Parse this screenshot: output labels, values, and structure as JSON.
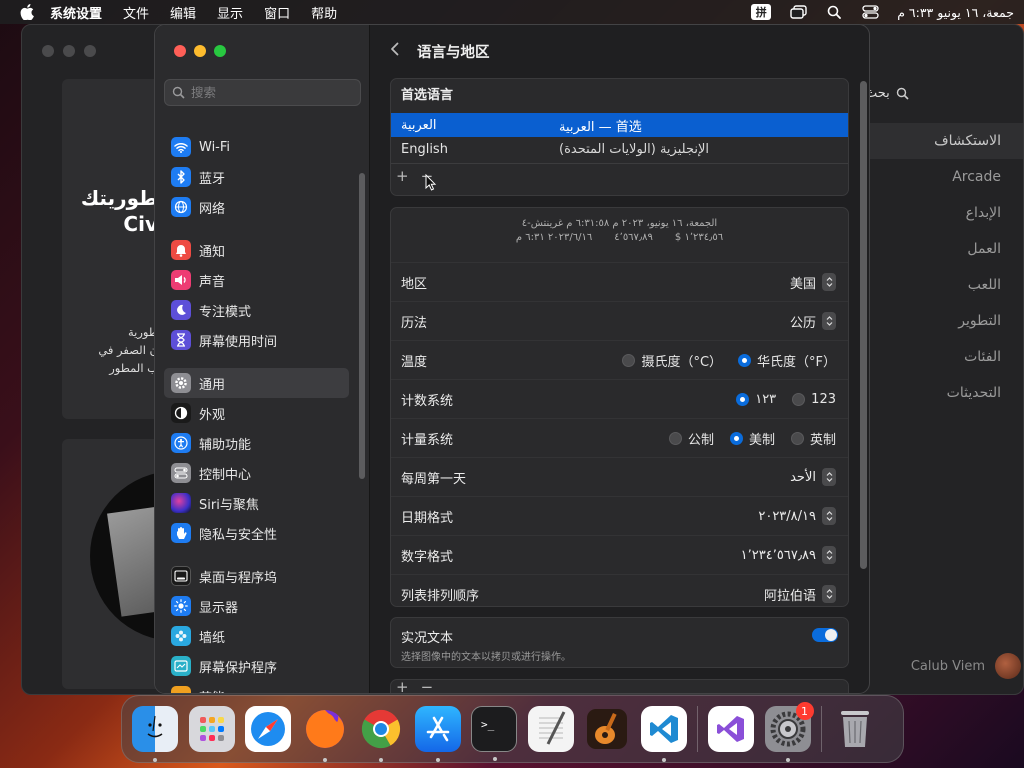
{
  "menubar": {
    "app_name": "系统设置",
    "menus": [
      "文件",
      "编辑",
      "显示",
      "窗口",
      "帮助"
    ],
    "input_method": "拼",
    "clock": "جمعة، ١٦ يونيو ٦:٣٣ م"
  },
  "appstore_bg": {
    "card_title_line1": "طوريتك",
    "card_title_line2": "Civ",
    "card_desc_line1": "طورية",
    "card_desc_line2": "ن الصفر في",
    "card_desc_line3": "ب المطور",
    "search_label": "بحث",
    "sidebar_items": [
      "الاستكشاف",
      "Arcade",
      "الإبداع",
      "العمل",
      "اللعب",
      "التطوير",
      "الفئات",
      "التحديثات"
    ],
    "account_name": "Calub Viem"
  },
  "sidebar": {
    "search_placeholder": "搜索",
    "items": [
      {
        "label": "Wi-Fi",
        "icon": "wifi-icon",
        "color": "#1e7cf2"
      },
      {
        "label": "蓝牙",
        "icon": "bluetooth-icon",
        "color": "#1e7cf2"
      },
      {
        "label": "网络",
        "icon": "globe-icon",
        "color": "#1e7cf2"
      },
      {
        "label": "通知",
        "icon": "bell-icon",
        "color": "#ee4b43"
      },
      {
        "label": "声音",
        "icon": "speaker-icon",
        "color": "#ee3c73"
      },
      {
        "label": "专注模式",
        "icon": "moon-icon",
        "color": "#5d4fd8"
      },
      {
        "label": "屏幕使用时间",
        "icon": "hourglass-icon",
        "color": "#5d4fd8"
      },
      {
        "label": "通用",
        "icon": "gear-icon",
        "color": "#8e8e93"
      },
      {
        "label": "外观",
        "icon": "appearance-icon",
        "color": "#1a1a1a"
      },
      {
        "label": "辅助功能",
        "icon": "accessibility-icon",
        "color": "#1e7cf2"
      },
      {
        "label": "控制中心",
        "icon": "control-center-icon",
        "color": "#8e8e93"
      },
      {
        "label": "Siri与聚焦",
        "icon": "siri-icon",
        "color": "#6b3fc0"
      },
      {
        "label": "隐私与安全性",
        "icon": "hand-icon",
        "color": "#1e7cf2"
      },
      {
        "label": "桌面与程序坞",
        "icon": "dock-icon",
        "color": "#1a1a1a"
      },
      {
        "label": "显示器",
        "icon": "sun-icon",
        "color": "#1e7cf2"
      },
      {
        "label": "墙纸",
        "icon": "flower-icon",
        "color": "#2aa8e0"
      },
      {
        "label": "屏幕保护程序",
        "icon": "screensaver-icon",
        "color": "#2ab0c8"
      },
      {
        "label": "节能",
        "icon": "battery-icon",
        "color": "#f0a020"
      }
    ]
  },
  "content": {
    "title": "语言与地区",
    "preferred_languages": {
      "header": "首选语言",
      "rows": [
        {
          "name": "العربية",
          "detail": "العربية — 首选",
          "selected": true
        },
        {
          "name": "English",
          "detail": "الإنجليزية (الولايات المتحدة)",
          "selected": false
        }
      ],
      "add": "+",
      "remove": "−"
    },
    "preview": {
      "line1": "الجمعة، ١٦ يونيو، ٢٠٢٣ م ٦:٣١:٥٨ م غرينتش-٤",
      "line2_a": "١٬٢٣٤٫٥٦ $",
      "line2_b": "٤٬٥٦٧٫٨٩",
      "line2_c": "٢٠٢٣/٦/١٦ ٦:٣١ م"
    },
    "region": {
      "label": "地区",
      "value": "美国"
    },
    "calendar": {
      "label": "历法",
      "value": "公历"
    },
    "temperature": {
      "label": "温度",
      "option1": "摄氏度（°C）",
      "option2": "华氏度（°F）",
      "selected": "option2"
    },
    "numbering": {
      "label": "计数系统",
      "option1": "١٢٣",
      "option2": "123",
      "selected": "option1"
    },
    "measurement": {
      "label": "计量系统",
      "option1": "公制",
      "option2": "美制",
      "option3": "英制",
      "selected": "option2"
    },
    "first_day": {
      "label": "每周第一天",
      "value": "الأحد"
    },
    "date_format": {
      "label": "日期格式",
      "value": "٢٠٢٣/٨/١٩"
    },
    "number_format": {
      "label": "数字格式",
      "value": "١٬٢٣٤٬٥٦٧٫٨٩"
    },
    "sort_order": {
      "label": "列表排列顺序",
      "value": "阿拉伯语"
    },
    "live_text": {
      "title": "实况文本",
      "subtitle": "选择图像中的文本以拷贝或进行操作。",
      "enabled": true
    },
    "tail_add": "+",
    "tail_remove": "−"
  },
  "dock": {
    "apps": [
      {
        "name": "Finder",
        "icon": "finder-icon",
        "running": true
      },
      {
        "name": "Launchpad",
        "icon": "launchpad-icon",
        "running": false
      },
      {
        "name": "Safari",
        "icon": "safari-icon",
        "running": false
      },
      {
        "name": "Firefox",
        "icon": "firefox-icon",
        "running": true
      },
      {
        "name": "Chrome",
        "icon": "chrome-icon",
        "running": true
      },
      {
        "name": "App Store",
        "icon": "app-store-icon",
        "running": true
      },
      {
        "name": "Terminal",
        "icon": "terminal-icon",
        "running": true
      },
      {
        "name": "TextEdit",
        "icon": "textedit-icon",
        "running": false
      },
      {
        "name": "GarageBand",
        "icon": "garageband-icon",
        "running": false
      },
      {
        "name": "VS Code",
        "icon": "vscode-icon",
        "running": true
      },
      {
        "name": "Visual Studio",
        "icon": "visual-studio-icon",
        "running": false
      },
      {
        "name": "System Settings",
        "icon": "system-settings-icon",
        "running": true,
        "badge": "1"
      },
      {
        "name": "Trash",
        "icon": "trash-icon",
        "running": false
      }
    ]
  }
}
